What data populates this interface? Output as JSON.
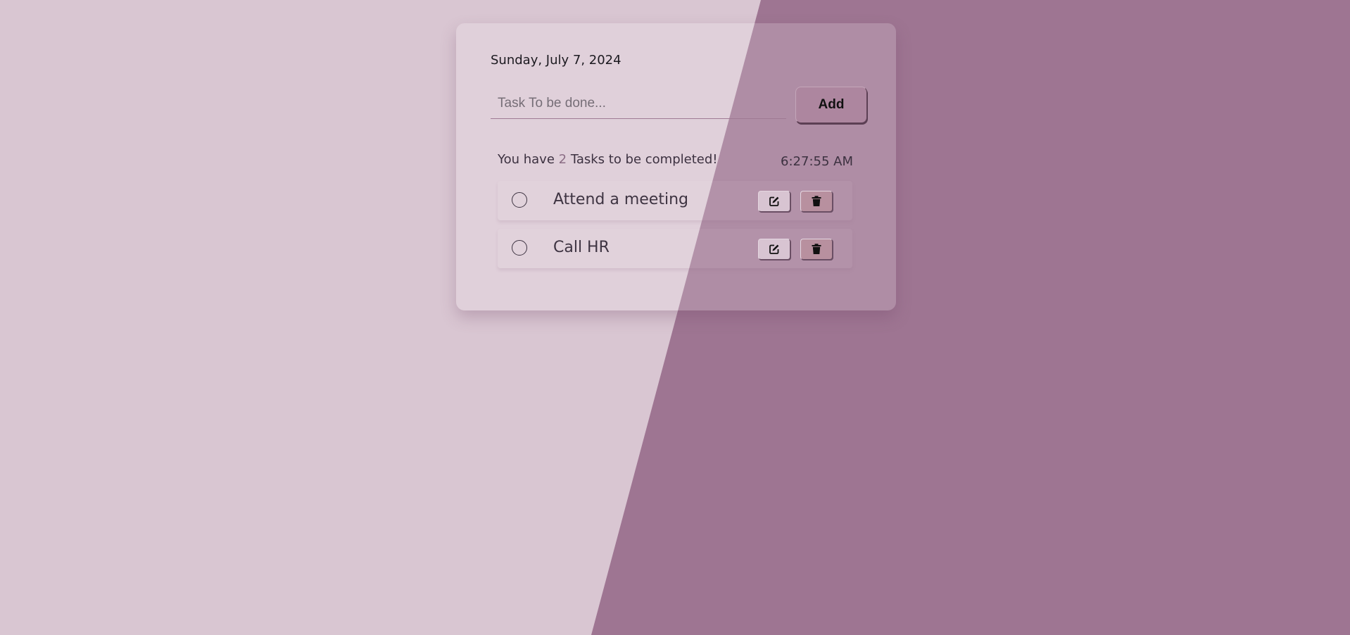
{
  "app": {
    "date": "Sunday, July 7, 2024",
    "clock": "6:27:55 AM"
  },
  "input": {
    "placeholder": "Task To be done...",
    "value": ""
  },
  "buttons": {
    "add_label": "Add"
  },
  "summary": {
    "prefix": "You have ",
    "count": "2",
    "suffix": " Tasks to be completed!"
  },
  "tasks": [
    {
      "text": "Attend a meeting",
      "done": false,
      "edit_icon": "edit-icon",
      "delete_icon": "trash-icon"
    },
    {
      "text": "Call HR",
      "done": false,
      "edit_icon": "edit-icon",
      "delete_icon": "trash-icon"
    }
  ],
  "colors": {
    "background_light": "#d9c6d2",
    "background_dark": "#9e7592",
    "accent": "#ad869f"
  }
}
